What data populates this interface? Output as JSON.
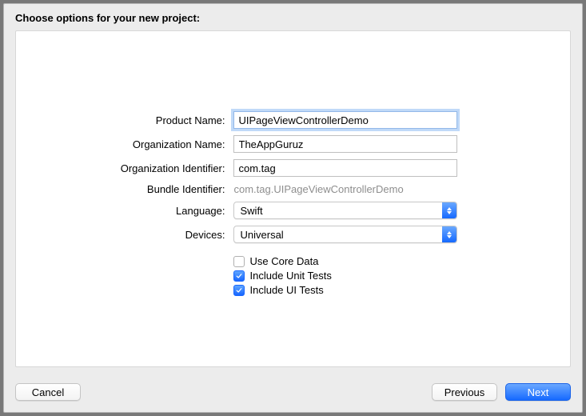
{
  "dialog": {
    "title": "Choose options for your new project:"
  },
  "form": {
    "product_name": {
      "label": "Product Name:",
      "value": "UIPageViewControllerDemo"
    },
    "org_name": {
      "label": "Organization Name:",
      "value": "TheAppGuruz"
    },
    "org_identifier": {
      "label": "Organization Identifier:",
      "value": "com.tag"
    },
    "bundle_identifier": {
      "label": "Bundle Identifier:",
      "value": "com.tag.UIPageViewControllerDemo"
    },
    "language": {
      "label": "Language:",
      "value": "Swift"
    },
    "devices": {
      "label": "Devices:",
      "value": "Universal"
    },
    "use_core_data": {
      "label": "Use Core Data",
      "checked": false
    },
    "include_unit_tests": {
      "label": "Include Unit Tests",
      "checked": true
    },
    "include_ui_tests": {
      "label": "Include UI Tests",
      "checked": true
    }
  },
  "buttons": {
    "cancel": "Cancel",
    "previous": "Previous",
    "next": "Next"
  }
}
